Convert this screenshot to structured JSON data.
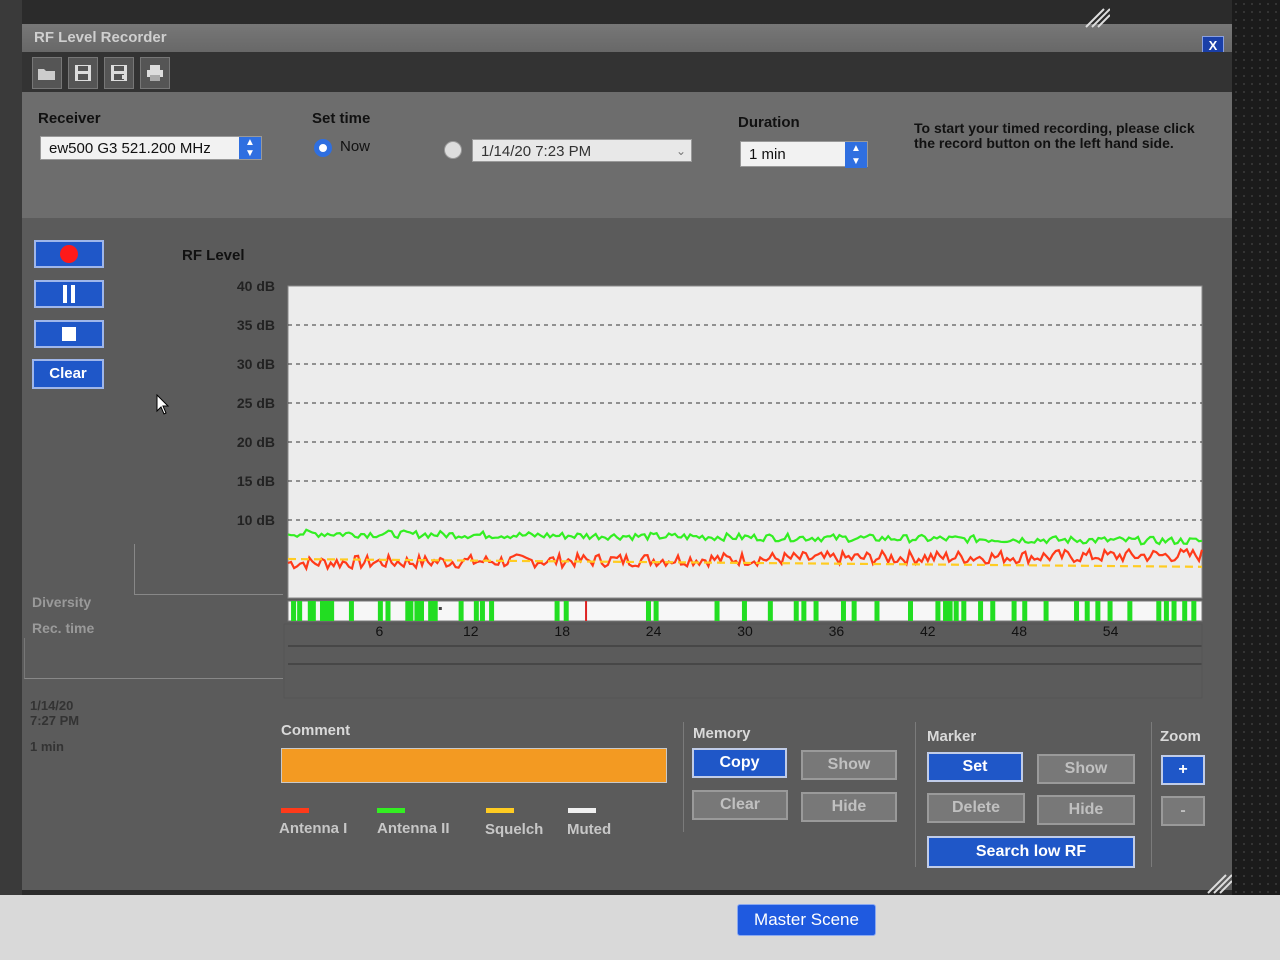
{
  "window": {
    "title": "RF Level Recorder",
    "close_label": "X"
  },
  "toolbar": {
    "icons": [
      "open-folder-icon",
      "save-icon",
      "save-as-icon",
      "print-icon"
    ]
  },
  "settings": {
    "receiver_label": "Receiver",
    "receiver_value": "ew500 G3 521.200 MHz",
    "set_time_label": "Set time",
    "now_label": "Now",
    "datetime_value": "1/14/20 7:23 PM",
    "duration_label": "Duration",
    "duration_value": "1 min",
    "hint": "To start your timed recording, please click the record button on the left hand side."
  },
  "controls": {
    "clear_label": "Clear"
  },
  "side": {
    "diversity": "Diversity",
    "rec_time": "Rec. time",
    "date": "1/14/20",
    "time": "7:27 PM",
    "duration": "1 min"
  },
  "chart_data": {
    "type": "line",
    "title": "RF Level",
    "yticks": [
      "40 dB",
      "35 dB",
      "30 dB",
      "25 dB",
      "20 dB",
      "15 dB",
      "10 dB"
    ],
    "ylim": [
      0,
      40
    ],
    "xlim": [
      0,
      60
    ],
    "xticks": [
      6,
      12,
      18,
      24,
      30,
      36,
      42,
      48,
      54
    ],
    "grid": "dashed horizontal",
    "series": [
      {
        "name": "Antenna I",
        "color": "#ff3a1a",
        "start": 4.5,
        "end": 5.5,
        "noise": 1.1
      },
      {
        "name": "Antenna II",
        "color": "#33ee22",
        "start": 8.3,
        "end": 7.3,
        "noise": 0.6
      },
      {
        "name": "Squelch",
        "color": "#ffcc22",
        "start": 5.0,
        "end": 4.0,
        "dashed": true
      }
    ],
    "diversity_marks_seconds": [
      0.2,
      0.6,
      1.3,
      1.5,
      2.1,
      2.4,
      2.7,
      4.0,
      5.9,
      6.4,
      7.7,
      7.9,
      8.3,
      8.6,
      9.2,
      9.5,
      11.2,
      12.2,
      12.6,
      13.2,
      17.5,
      18.1,
      23.5,
      24.0,
      28.0,
      29.8,
      31.5,
      33.2,
      33.7,
      34.5,
      36.3,
      37.0,
      38.5,
      40.7,
      42.5,
      43.0,
      43.3,
      43.7,
      44.2,
      45.3,
      46.1,
      47.5,
      48.2,
      49.6,
      51.6,
      52.3,
      53.0,
      53.8,
      55.1,
      57.0,
      57.5,
      58.0,
      58.7,
      59.3
    ],
    "diversity_red_marks_seconds": [
      19.5
    ],
    "diversity_white_marks_seconds": [
      9.9
    ]
  },
  "legend": {
    "antenna1": "Antenna I",
    "antenna2": "Antenna II",
    "squelch": "Squelch",
    "muted": "Muted",
    "colors": {
      "antenna1": "#ff3a1a",
      "antenna2": "#33ee22",
      "squelch": "#ffcc22",
      "muted": "#f0f0f0"
    }
  },
  "comment": {
    "label": "Comment",
    "value": ""
  },
  "memory": {
    "label": "Memory",
    "copy": "Copy",
    "show": "Show",
    "clear": "Clear",
    "hide": "Hide"
  },
  "marker": {
    "label": "Marker",
    "set": "Set",
    "show": "Show",
    "delete": "Delete",
    "hide": "Hide",
    "search": "Search low RF"
  },
  "zoom": {
    "label": "Zoom",
    "plus": "+",
    "minus": "-"
  },
  "taskbar": {
    "master_scene": "Master Scene"
  }
}
